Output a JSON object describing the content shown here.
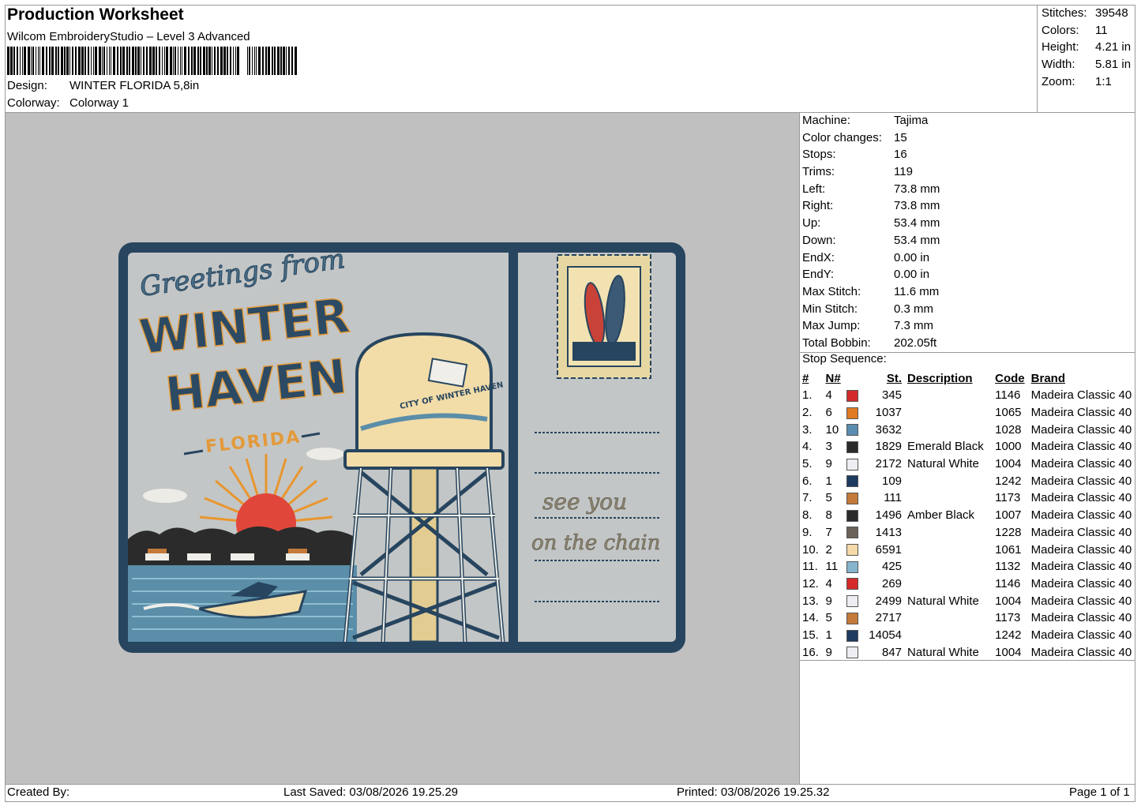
{
  "header": {
    "title": "Production Worksheet",
    "software": "Wilcom EmbroideryStudio – Level 3 Advanced",
    "design_label": "Design:",
    "design_value": "WINTER FLORIDA 5,8in",
    "colorway_label": "Colorway:",
    "colorway_value": "Colorway 1"
  },
  "stats": [
    {
      "label": "Stitches:",
      "value": "39548"
    },
    {
      "label": "Colors:",
      "value": "11"
    },
    {
      "label": "Height:",
      "value": "4.21 in"
    },
    {
      "label": "Width:",
      "value": "5.81 in"
    },
    {
      "label": "Zoom:",
      "value": "1:1"
    }
  ],
  "machine_stats": [
    {
      "label": "Machine:",
      "value": "Tajima"
    },
    {
      "label": "Color changes:",
      "value": "15"
    },
    {
      "label": "Stops:",
      "value": "16"
    },
    {
      "label": "Trims:",
      "value": "119"
    },
    {
      "label": "Left:",
      "value": "73.8 mm"
    },
    {
      "label": "Right:",
      "value": "73.8 mm"
    },
    {
      "label": "Up:",
      "value": "53.4 mm"
    },
    {
      "label": "Down:",
      "value": "53.4 mm"
    },
    {
      "label": "EndX:",
      "value": "0.00 in"
    },
    {
      "label": "EndY:",
      "value": "0.00 in"
    },
    {
      "label": "Max Stitch:",
      "value": "11.6 mm"
    },
    {
      "label": "Min Stitch:",
      "value": "0.3 mm"
    },
    {
      "label": "Max Jump:",
      "value": "7.3 mm"
    },
    {
      "label": "Total Bobbin:",
      "value": "202.05ft"
    }
  ],
  "stop_sequence": {
    "title": "Stop Sequence:",
    "headers": {
      "num": "#",
      "needle": "N#",
      "stitches": "St.",
      "description": "Description",
      "code": "Code",
      "brand": "Brand"
    },
    "rows": [
      {
        "num": "1.",
        "needle": "4",
        "color": "#d42a2a",
        "stitches": "345",
        "description": "",
        "code": "1146",
        "brand": "Madeira Classic 40"
      },
      {
        "num": "2.",
        "needle": "6",
        "color": "#e07b23",
        "stitches": "1037",
        "description": "",
        "code": "1065",
        "brand": "Madeira Classic 40"
      },
      {
        "num": "3.",
        "needle": "10",
        "color": "#5a8db0",
        "stitches": "3632",
        "description": "",
        "code": "1028",
        "brand": "Madeira Classic 40"
      },
      {
        "num": "4.",
        "needle": "3",
        "color": "#2a2a2a",
        "stitches": "1829",
        "description": "Emerald Black",
        "code": "1000",
        "brand": "Madeira Classic 40"
      },
      {
        "num": "5.",
        "needle": "9",
        "color": "#eeeef2",
        "stitches": "2172",
        "description": "Natural White",
        "code": "1004",
        "brand": "Madeira Classic 40"
      },
      {
        "num": "6.",
        "needle": "1",
        "color": "#1d3a5f",
        "stitches": "109",
        "description": "",
        "code": "1242",
        "brand": "Madeira Classic 40"
      },
      {
        "num": "7.",
        "needle": "5",
        "color": "#c47a3a",
        "stitches": "111",
        "description": "",
        "code": "1173",
        "brand": "Madeira Classic 40"
      },
      {
        "num": "8.",
        "needle": "8",
        "color": "#2b2b2b",
        "stitches": "1496",
        "description": "Amber Black",
        "code": "1007",
        "brand": "Madeira Classic 40"
      },
      {
        "num": "9.",
        "needle": "7",
        "color": "#6b6259",
        "stitches": "1413",
        "description": "",
        "code": "1228",
        "brand": "Madeira Classic 40"
      },
      {
        "num": "10.",
        "needle": "2",
        "color": "#f5d9a8",
        "stitches": "6591",
        "description": "",
        "code": "1061",
        "brand": "Madeira Classic 40"
      },
      {
        "num": "11.",
        "needle": "11",
        "color": "#86b4cc",
        "stitches": "425",
        "description": "",
        "code": "1132",
        "brand": "Madeira Classic 40"
      },
      {
        "num": "12.",
        "needle": "4",
        "color": "#d42a2a",
        "stitches": "269",
        "description": "",
        "code": "1146",
        "brand": "Madeira Classic 40"
      },
      {
        "num": "13.",
        "needle": "9",
        "color": "#eeeef2",
        "stitches": "2499",
        "description": "Natural White",
        "code": "1004",
        "brand": "Madeira Classic 40"
      },
      {
        "num": "14.",
        "needle": "5",
        "color": "#c47a3a",
        "stitches": "2717",
        "description": "",
        "code": "1173",
        "brand": "Madeira Classic 40"
      },
      {
        "num": "15.",
        "needle": "1",
        "color": "#1d3a5f",
        "stitches": "14054",
        "description": "",
        "code": "1242",
        "brand": "Madeira Classic 40"
      },
      {
        "num": "16.",
        "needle": "9",
        "color": "#eeeef2",
        "stitches": "847",
        "description": "Natural White",
        "code": "1004",
        "brand": "Madeira Classic 40"
      }
    ]
  },
  "design": {
    "greeting": "Greetings from",
    "line1": "WINTER",
    "line2": "HAVEN",
    "state": "FLORIDA",
    "tower_text": "CITY OF WINTER HAVEN",
    "slogan1": "see you",
    "slogan2": "on the chain"
  },
  "footer": {
    "created": "Created By:",
    "saved": "Last Saved: 03/08/2026 19.25.29",
    "printed": "Printed: 03/08/2026 19.25.32",
    "page": "Page 1 of 1"
  }
}
